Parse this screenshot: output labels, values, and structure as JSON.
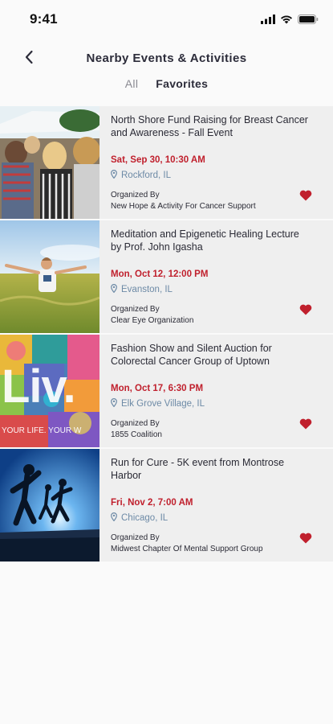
{
  "status_bar": {
    "time": "9:41",
    "icons": [
      "cellular-signal-icon",
      "wifi-icon",
      "battery-icon"
    ]
  },
  "header": {
    "back_icon": "chevron-left-icon",
    "title": "Nearby Events & Activities"
  },
  "tabs": [
    {
      "label": "All",
      "active": false
    },
    {
      "label": "Favorites",
      "active": true
    }
  ],
  "colors": {
    "date_red": "#c0202d",
    "location_blue": "#6d8aa6",
    "heart_red": "#c0202d",
    "card_bg": "#efefef"
  },
  "events": [
    {
      "title": "North Shore Fund Raising for Breast Cancer and Awareness - Fall Event",
      "date": "Sat, Sep 30, 10:30 AM",
      "location": "Rockford, IL",
      "organized_by_label": "Organized By",
      "organizer": "New Hope & Activity For Cancer Support",
      "favorited": true
    },
    {
      "title": "Meditation and Epigenetic Healing Lecture by Prof. John Igasha",
      "date": "Mon, Oct 12, 12:00 PM",
      "location": "Evanston, IL",
      "organized_by_label": "Organized By",
      "organizer": "Clear Eye Organization",
      "favorited": true
    },
    {
      "title": "Fashion Show and Silent Auction for Colorectal Cancer Group of Uptown",
      "date": "Mon, Oct 17, 6:30 PM",
      "location": "Elk Grove Village, IL",
      "organized_by_label": "Organized By",
      "organizer": "1855 Coalition",
      "favorited": true,
      "image_text": "Liv.",
      "image_subtext": "YOUR LIFE. YOUR W"
    },
    {
      "title": "Run for Cure - 5K event from Montrose Harbor",
      "date": "Fri, Nov 2, 7:00 AM",
      "location": "Chicago, IL",
      "organized_by_label": "Organized By",
      "organizer": "Midwest Chapter Of Mental Support Group",
      "favorited": true
    }
  ]
}
